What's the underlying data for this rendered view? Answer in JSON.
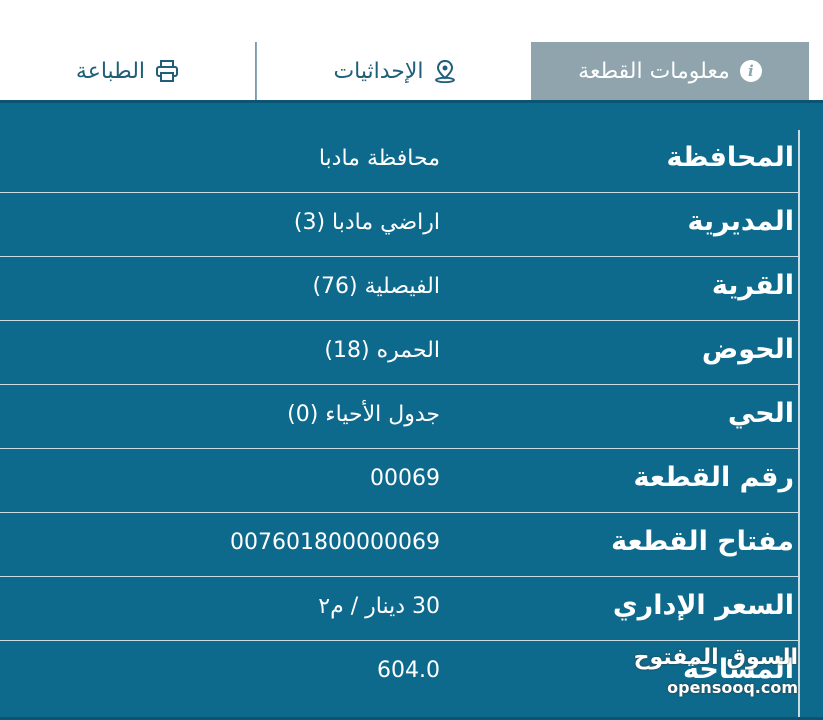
{
  "tabs": {
    "print": {
      "label": "الطباعة",
      "icon": "printer-icon"
    },
    "coords": {
      "label": "الإحداثيات",
      "icon": "map-pin-icon"
    },
    "info": {
      "label": "معلومات القطعة",
      "icon": "info-icon",
      "active": true
    }
  },
  "rows": [
    {
      "label": "المحافظة",
      "value": "محافظة مادبا"
    },
    {
      "label": "المديرية",
      "value": "اراضي مادبا (3)"
    },
    {
      "label": "القرية",
      "value": "الفيصلية (76)"
    },
    {
      "label": "الحوض",
      "value": "الحمره (18)"
    },
    {
      "label": "الحي",
      "value": "جدول الأحياء (0)"
    },
    {
      "label": "رقم القطعة",
      "value": "00069"
    },
    {
      "label": "مفتاح القطعة",
      "value": "007601800000069"
    },
    {
      "label": "السعر الإداري",
      "value": "30 دينار / م٢"
    },
    {
      "label": "المساحة",
      "value": "604.0"
    }
  ],
  "watermark": {
    "ar": "السوق المفتوح",
    "en": "opensooq.com"
  },
  "colors": {
    "panel": "#0e6a8c",
    "active_tab": "#8fa4ad",
    "tab_text": "#1f5f79"
  }
}
